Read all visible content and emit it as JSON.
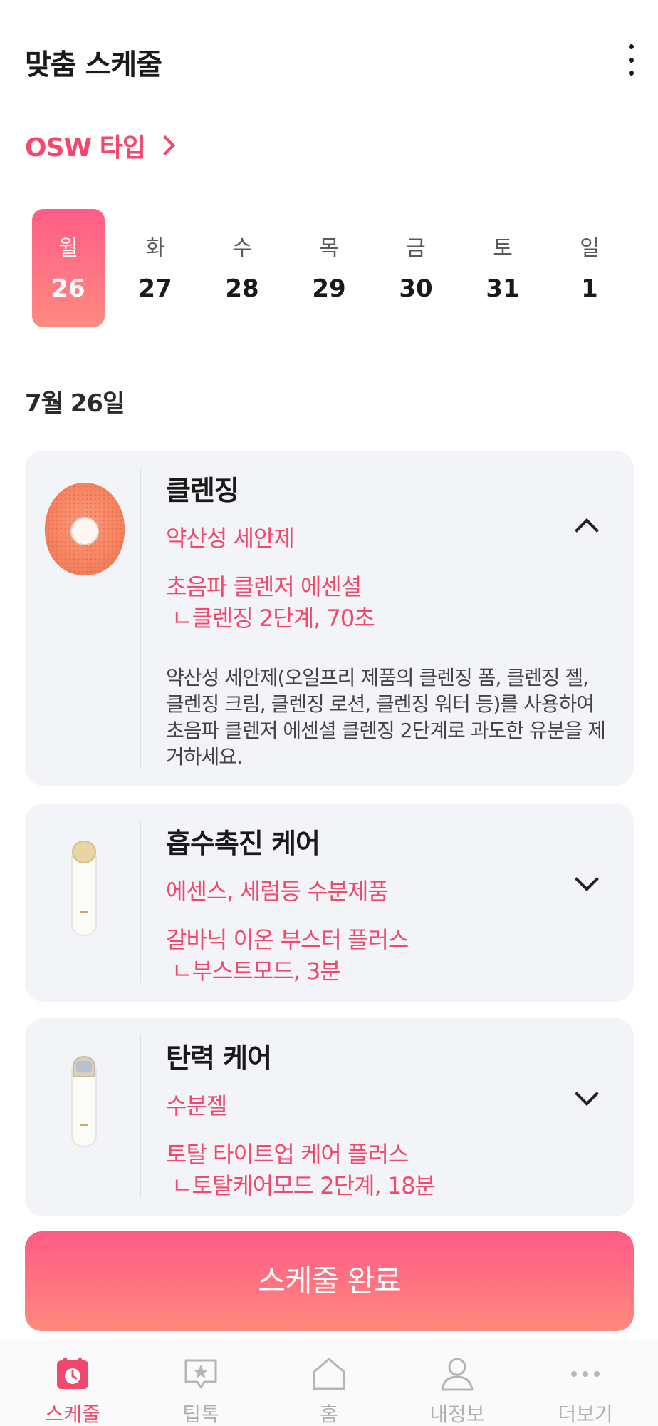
{
  "header": {
    "title": "맞춤 스케줄",
    "more_icon": "more-vertical-icon"
  },
  "skin_type": {
    "label": "OSW 타입",
    "icon": "chevron-right-icon"
  },
  "week": [
    {
      "dow": "월",
      "date": "26",
      "selected": true
    },
    {
      "dow": "화",
      "date": "27",
      "selected": false
    },
    {
      "dow": "수",
      "date": "28",
      "selected": false
    },
    {
      "dow": "목",
      "date": "29",
      "selected": false
    },
    {
      "dow": "금",
      "date": "30",
      "selected": false
    },
    {
      "dow": "토",
      "date": "31",
      "selected": false
    },
    {
      "dow": "일",
      "date": "1",
      "selected": false
    }
  ],
  "date_heading": "7월 26일",
  "cards": [
    {
      "title": "클렌징",
      "product": "약산성 세안제",
      "device": "초음파 클렌저 에센셜",
      "step": "ㄴ클렌징 2단계, 70초",
      "description": "약산성 세안제(오일프리 제품의 클렌징 폼, 클렌징 젤, 클렌징 크림, 클렌징 로션, 클렌징 워터 등)를 사용하여 초음파 클렌저 에센셜 클렌징 2단계로 과도한 유분을 제거하세요.",
      "expanded": true,
      "image": "cleanser-device-image"
    },
    {
      "title": "흡수촉진 케어",
      "product": "에센스, 세럼등 수분제품",
      "device": "갈바닉 이온 부스터 플러스",
      "step": "ㄴ부스트모드, 3분",
      "expanded": false,
      "image": "galvanic-booster-image"
    },
    {
      "title": "탄력 케어",
      "product": "수분젤",
      "device": "토탈 타이트업 케어 플러스",
      "step": "ㄴ토탈케어모드 2단계, 18분",
      "expanded": false,
      "image": "tightup-device-image"
    }
  ],
  "complete_button": "스케줄 완료",
  "tabbar": [
    {
      "label": "스케줄",
      "icon": "calendar-clock-icon",
      "active": true
    },
    {
      "label": "팁톡",
      "icon": "star-chat-icon",
      "active": false
    },
    {
      "label": "홈",
      "icon": "home-icon",
      "active": false
    },
    {
      "label": "내정보",
      "icon": "user-icon",
      "active": false
    },
    {
      "label": "더보기",
      "icon": "more-horizontal-icon",
      "active": false
    }
  ],
  "colors": {
    "accent": "#f2486e",
    "gradient_start": "#ff5a86",
    "gradient_end": "#ff8a7c",
    "card_bg": "#f3f4f8"
  }
}
